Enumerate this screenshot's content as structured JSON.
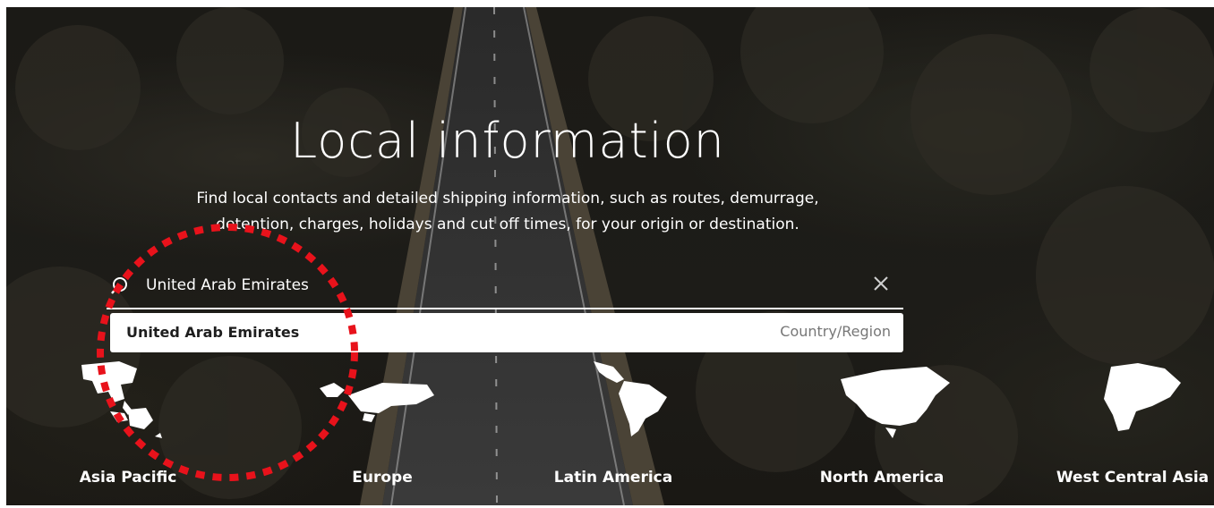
{
  "hero": {
    "title": "Local information",
    "subtitle_line1": "Find local contacts and detailed shipping information, such as routes, demurrage,",
    "subtitle_line2": "detention, charges, holidays and cut off times, for your origin or destination."
  },
  "search": {
    "value": "United Arab Emirates",
    "icon": "search-icon",
    "clear_icon": "close-icon"
  },
  "suggestions": [
    {
      "name": "United Arab Emirates",
      "type": "Country/Region"
    }
  ],
  "regions": [
    {
      "label": "Asia Pacific",
      "icon": "asia-pacific-map-icon"
    },
    {
      "label": "Europe",
      "icon": "europe-map-icon"
    },
    {
      "label": "Latin America",
      "icon": "latin-america-map-icon"
    },
    {
      "label": "North America",
      "icon": "north-america-map-icon"
    },
    {
      "label": "West Central Asia",
      "icon": "west-central-asia-map-icon"
    }
  ],
  "colors": {
    "annotation": "#e8121b",
    "text": "#ffffff",
    "dropdown_bg": "#ffffff"
  }
}
